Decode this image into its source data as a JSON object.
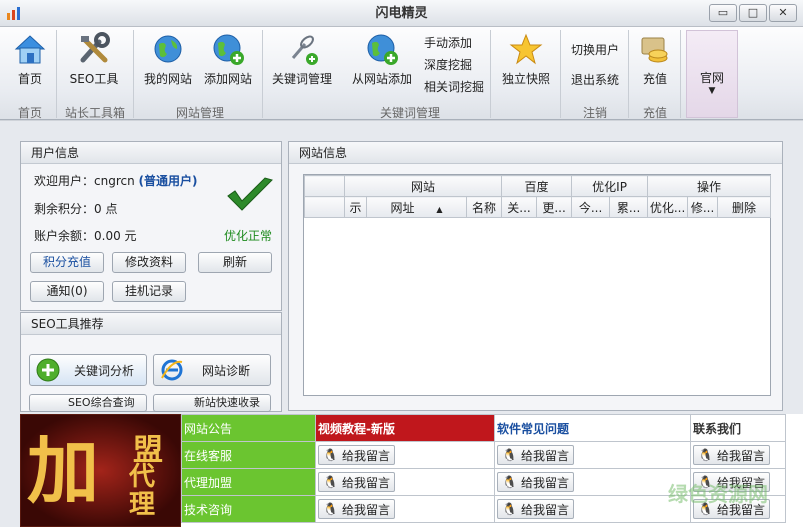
{
  "window": {
    "title": "闪电精灵",
    "minimize": "▭",
    "restore": "□",
    "close": "✕"
  },
  "ribbon": {
    "buttons": {
      "home": "首页",
      "seo_tools": "SEO工具",
      "my_sites": "我的网站",
      "add_site": "添加网站",
      "keyword_mgmt": "关键词管理",
      "add_from_site": "从网站添加",
      "manual_add": "手动添加",
      "deep_mining": "深度挖掘",
      "related_mining": "相关词挖掘",
      "snapshot": "独立快照",
      "switch_user": "切换用户",
      "exit": "退出系统",
      "recharge": "充值",
      "official": "官网"
    },
    "groups": {
      "home": "首页",
      "toolbox": "站长工具箱",
      "site_mgmt": "网站管理",
      "keyword_mgmt": "关键词管理",
      "logout": "注销",
      "recharge": "充值"
    }
  },
  "user_panel": {
    "title": "用户信息",
    "welcome_label": "欢迎用户：cngrcn",
    "user_type": "(普通用户)",
    "points": "剩余积分：0 点",
    "balance": "账户余额：0.00 元",
    "status": "优化正常",
    "buttons": {
      "recharge_points": "积分充值",
      "edit_profile": "修改资料",
      "refresh": "刷新",
      "notice": "通知(0)",
      "hang_log": "挂机记录"
    }
  },
  "seo_panel": {
    "title": "SEO工具推荐",
    "keyword_analysis": "关键词分析",
    "site_diagnosis": "网站诊断",
    "seo_query": "SEO综合查询",
    "new_site_submit": "新站快速收录"
  },
  "site_panel": {
    "title": "网站信息",
    "group_headers": [
      "网站",
      "百度",
      "优化IP",
      "操作"
    ],
    "columns": [
      "",
      "示",
      "网址",
      "名称",
      "关...",
      "更...",
      "今...",
      "累...",
      "优化...",
      "修...",
      "删除"
    ]
  },
  "bottom": {
    "ad_main": "加",
    "ad_sub1": "盟",
    "ad_sub2": "代理",
    "rows": [
      {
        "label": "网站公告"
      },
      {
        "label": "在线客服"
      },
      {
        "label": "代理加盟"
      },
      {
        "label": "技术咨询"
      }
    ],
    "headers": {
      "video": "视频教程-新版",
      "faq": "软件常见问题",
      "contact": "联系我们"
    },
    "leave_msg": "给我留言"
  },
  "watermark": "绿色资源网",
  "colors": {
    "accent_blue": "#1a4fa0",
    "green_cell": "#6bc530",
    "status_green": "#1d8a1d",
    "red_header": "#c0171c"
  }
}
